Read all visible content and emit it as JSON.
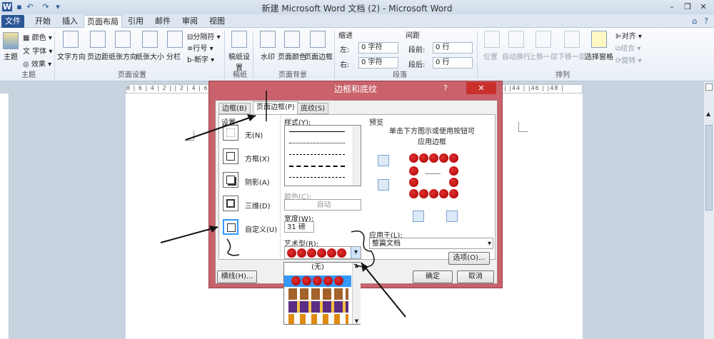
{
  "window": {
    "title": "新建 Microsoft Word 文档 (2) - Microsoft Word",
    "app_icon": "W"
  },
  "quick_access": [
    "save-icon",
    "undo-icon",
    "redo-icon",
    "customize-icon"
  ],
  "window_controls": {
    "minimize": "–",
    "restore": "❐",
    "close": "✕"
  },
  "tabs": [
    "文件",
    "开始",
    "插入",
    "页面布局",
    "引用",
    "邮件",
    "审阅",
    "视图"
  ],
  "ribbon": {
    "themes": {
      "label": "主题",
      "btn": "主题",
      "colors": "颜色",
      "fonts": "字体",
      "effects": "效果"
    },
    "page_setup": {
      "label": "页面设置",
      "text_dir": "文字方向",
      "margins": "页边距",
      "orientation": "纸张方向",
      "size": "纸张大小",
      "columns": "分栏",
      "breaks": "分隔符",
      "line_numbers": "行号",
      "hyphenation": "断字"
    },
    "draft": {
      "label": "稿纸",
      "btn": "稿纸设置"
    },
    "background": {
      "label": "页面背景",
      "watermark": "水印",
      "page_color": "页面颜色",
      "page_border": "页面边框"
    },
    "paragraph": {
      "label": "段落",
      "indent": "缩进",
      "spacing": "间距",
      "left": "左:",
      "right": "右:",
      "before": "段前:",
      "after": "段后:",
      "left_val": "0 字符",
      "right_val": "0 字符",
      "before_val": "0 行",
      "after_val": "0 行"
    },
    "arrange": {
      "label": "排列",
      "position": "位置",
      "wrap": "自动换行",
      "bring_fwd": "上移一层",
      "send_back": "下移一层",
      "selection_pane": "选择窗格",
      "align": "对齐",
      "group": "组合",
      "rotate": "旋转"
    }
  },
  "ruler": "8 | 6 | 4 | 2 |  | 2 | 4 | 6 | 8 | 10 | 12 | 14 | 16 | 18 | 20 | 22 | 24 | 26 | 28 | 30 | 32 | 34 | 36 | 38 | |40 | 42 | |44 | |46 | |48 |",
  "dialog": {
    "title": "边框和底纹",
    "help": "?",
    "tabs": [
      "边框(B)",
      "页面边框(P)",
      "底纹(S)"
    ],
    "setting_label": "设置:",
    "settings": [
      "无(N)",
      "方框(X)",
      "阴影(A)",
      "三维(D)",
      "自定义(U)"
    ],
    "style_label": "样式(Y):",
    "color_label": "颜色(C):",
    "color_value": "自动",
    "width_label": "宽度(W):",
    "width_value": "31 磅",
    "art_label": "艺术型(R):",
    "preview_label": "预览",
    "preview_hint": "单击下方图示或使用按钮可应用边框",
    "apply_label": "应用于(L):",
    "apply_value": "整篇文档",
    "options_btn": "选项(O)...",
    "hline_btn": "横线(H)...",
    "ok_btn": "确定",
    "cancel_btn": "取消",
    "art_dropdown": {
      "none": "(无)"
    }
  },
  "colors": {
    "file_tab": "#2b5797",
    "dialog_border": "#c9626a",
    "close": "#c9302c",
    "apple": "#c00000"
  }
}
